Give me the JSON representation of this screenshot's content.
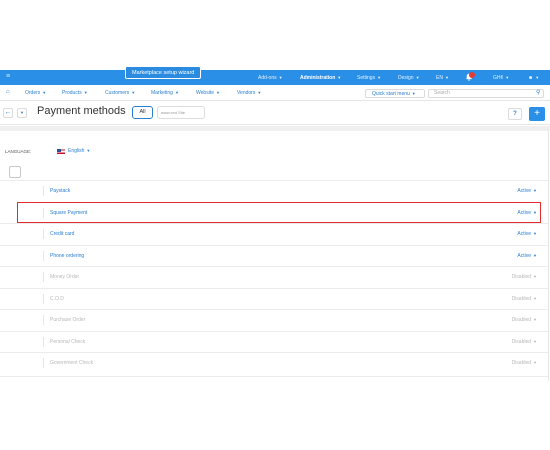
{
  "top_bar": {
    "wizard_label": "Marketplace setup wizard",
    "items": [
      {
        "label": "Add-ons"
      },
      {
        "label": "Administration"
      },
      {
        "label": "Settings"
      },
      {
        "label": "Design"
      },
      {
        "label": "EN"
      },
      {
        "label": "GH¢"
      }
    ],
    "notification_badge": "0",
    "accent_color": "#2a8fe6"
  },
  "sub_nav": {
    "items": [
      {
        "label": "Orders"
      },
      {
        "label": "Products"
      },
      {
        "label": "Customers"
      },
      {
        "label": "Marketing"
      },
      {
        "label": "Website"
      },
      {
        "label": "Vendors"
      }
    ],
    "quick_start_label": "Quick start menu",
    "search_placeholder": "Search"
  },
  "title_bar": {
    "page_title": "Payment methods",
    "tab_all_label": "All",
    "storefront_label": "www.ced Site"
  },
  "language": {
    "label": "LANGUAGE:",
    "value": "English"
  },
  "payment_methods": [
    {
      "name": "Paystack",
      "status": "Active"
    },
    {
      "name": "Square Payment",
      "status": "Active"
    },
    {
      "name": "Credit card",
      "status": "Active"
    },
    {
      "name": "Phone ordering",
      "status": "Active"
    },
    {
      "name": "Money Order",
      "status": "Disabled"
    },
    {
      "name": "C.O.D",
      "status": "Disabled"
    },
    {
      "name": "Purchase Order",
      "status": "Disabled"
    },
    {
      "name": "Personal Check",
      "status": "Disabled"
    },
    {
      "name": "Government Check",
      "status": "Disabled"
    }
  ]
}
